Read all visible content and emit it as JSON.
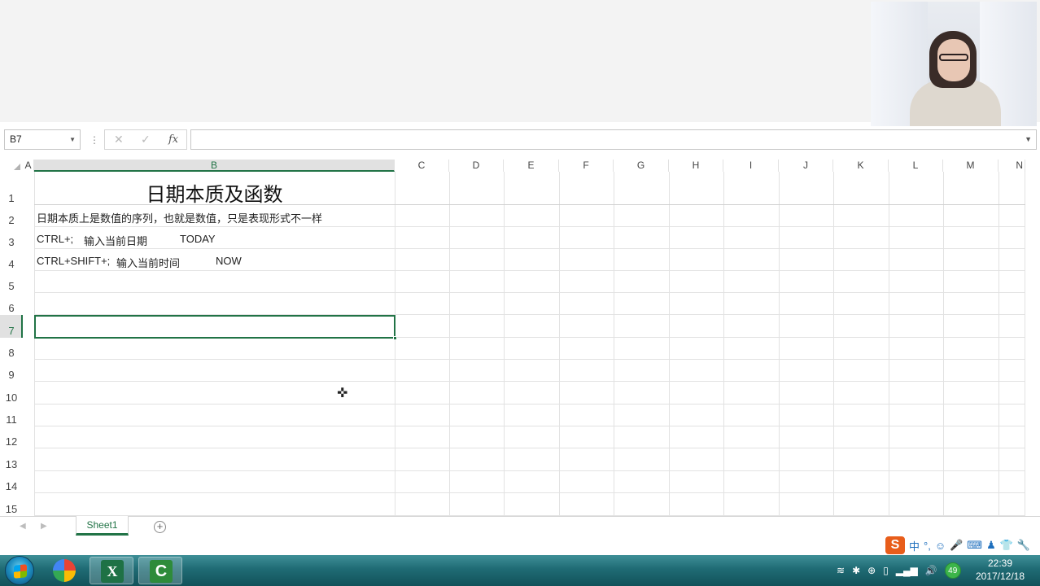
{
  "namebox": {
    "value": "B7"
  },
  "formula_bar": {
    "value": "",
    "cancel_icon": "✕",
    "enter_icon": "✓",
    "fx_label": "fx"
  },
  "columns": [
    "A",
    "B",
    "C",
    "D",
    "E",
    "F",
    "G",
    "H",
    "I",
    "J",
    "K",
    "L",
    "M",
    "N"
  ],
  "selected_column": "B",
  "rows": [
    "1",
    "2",
    "3",
    "4",
    "5",
    "6",
    "7",
    "8",
    "9",
    "10",
    "11",
    "12",
    "13",
    "14",
    "15"
  ],
  "selected_row": "7",
  "cells": {
    "B1": "日期本质及函数",
    "B2": "日期本质上是数值的序列，也就是数值，只是表现形式不一样",
    "B3a": "CTRL+;",
    "B3b": "输入当前日期",
    "B3c": "TODAY",
    "B4a": "CTRL+SHIFT+;",
    "B4b": "输入当前时间",
    "B4c": "NOW"
  },
  "sheet_tabs": [
    "Sheet1"
  ],
  "ime_toolbar": {
    "logo": "S",
    "lang": "中"
  },
  "tray": {
    "badge": "49"
  },
  "clock": {
    "time": "22:39",
    "date": "2017/12/18"
  },
  "colors": {
    "accent": "#217346",
    "taskbar": "#1f6b74"
  }
}
